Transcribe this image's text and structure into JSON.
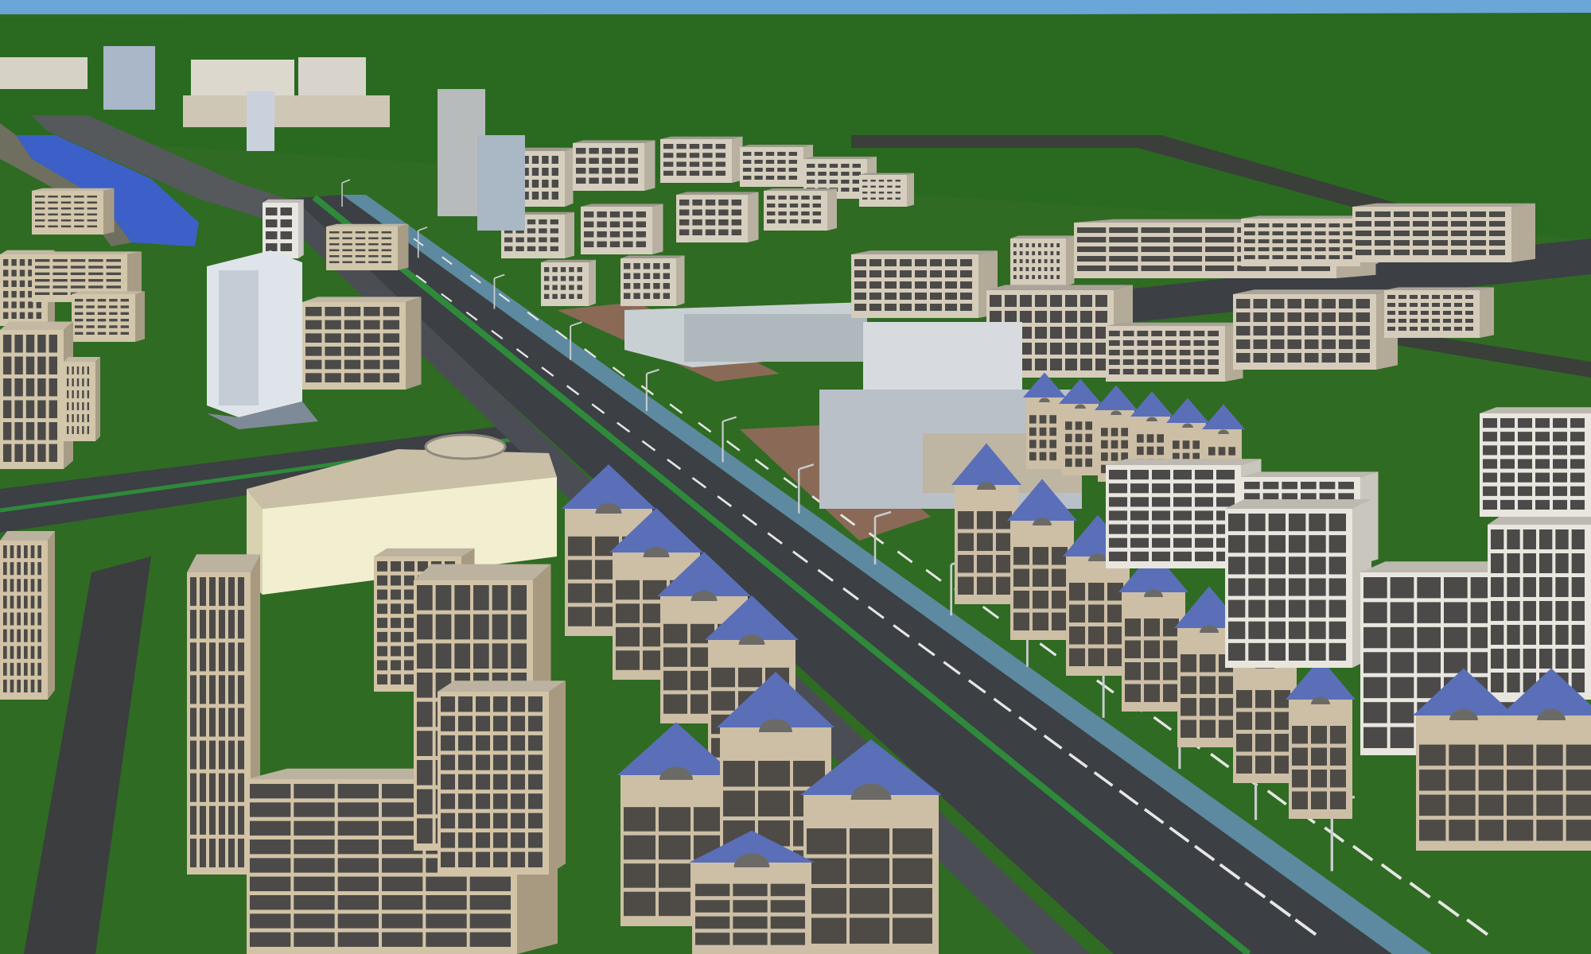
{
  "scene": {
    "kind": "3D city rendering, aerial view",
    "sky_color": "#6aa6d8",
    "grass_color": "#2f6b22",
    "road_color": "#3c3f44",
    "lane_stripe_color": "#e6e6e6",
    "median_color": "#2e8a3a",
    "river_color": "#3d5fc8",
    "roof_blue": "#5a6fb8",
    "facade_beige": "#d2c3a6",
    "facade_white": "#e8e6df",
    "plaza_color": "#8a6a56",
    "mall_color": "#f2eed0"
  }
}
